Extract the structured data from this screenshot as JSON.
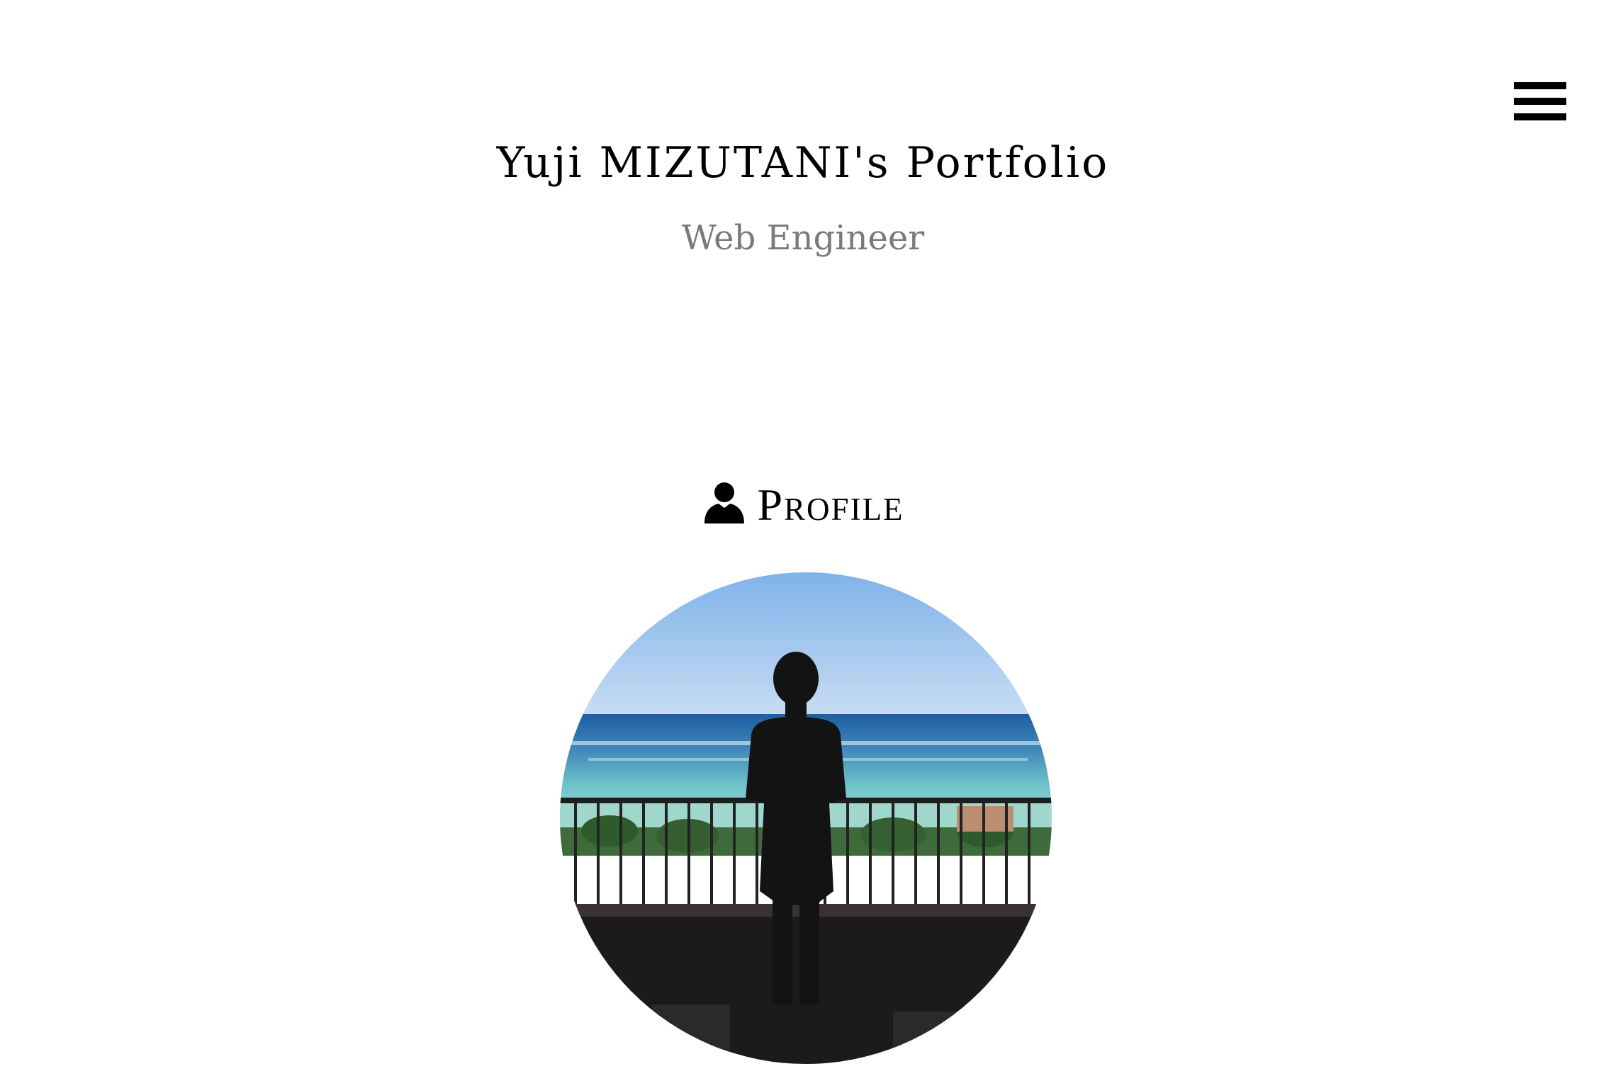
{
  "header": {
    "title": "Yuji MIZUTANI's Portfolio",
    "subtitle": "Web Engineer",
    "menu_icon": "hamburger-menu-icon"
  },
  "profile": {
    "heading": "Profile",
    "heading_icon": "user-icon",
    "photo_alt": "Profile photo"
  },
  "colors": {
    "background": "#ffffff",
    "title": "#000000",
    "subtitle": "#7a7a7a"
  }
}
